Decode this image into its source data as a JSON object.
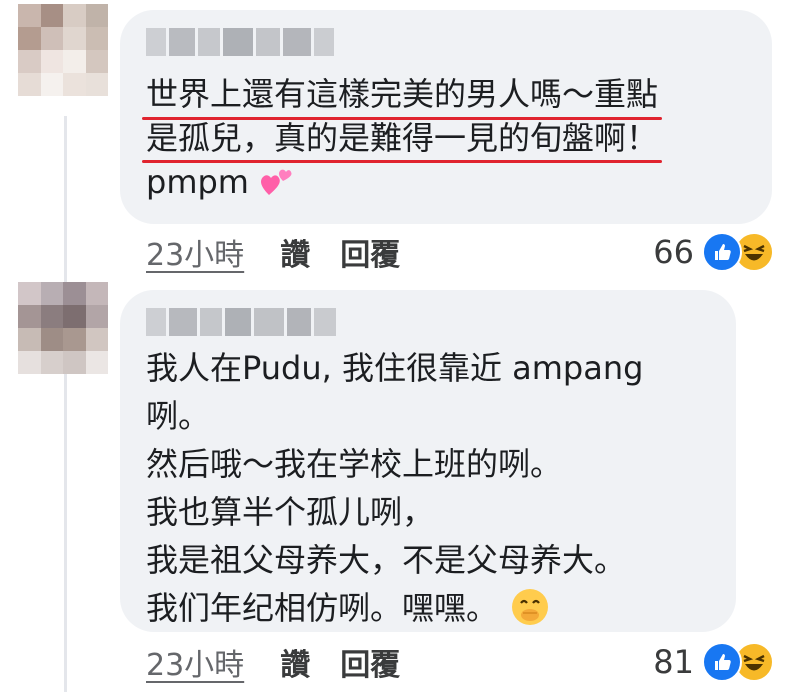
{
  "comments": [
    {
      "lines": [
        "世界上還有這樣完美的男人嗎～重點",
        "是孤兒，真的是難得一見的旬盤啊！",
        "pmpm"
      ],
      "emoji": "two-hearts",
      "time": "23小時",
      "like_label": "讚",
      "reply_label": "回覆",
      "reaction_count": "66"
    },
    {
      "lines": [
        "我人在Pudu, 我住很靠近 ampang",
        "咧。",
        "然后哦～我在学校上班的咧。",
        "我也算半个孤儿咧，",
        "我是祖父母养大，不是父母养大。",
        "我们年纪相仿咧。嘿嘿。"
      ],
      "emoji": "hand-over-mouth",
      "time": "23小時",
      "like_label": "讚",
      "reply_label": "回覆",
      "reaction_count": "81"
    }
  ],
  "colors": {
    "bubble": "#f0f2f5",
    "underline": "#e0242f",
    "like": "#1877f2",
    "haha": "#f7b928"
  }
}
